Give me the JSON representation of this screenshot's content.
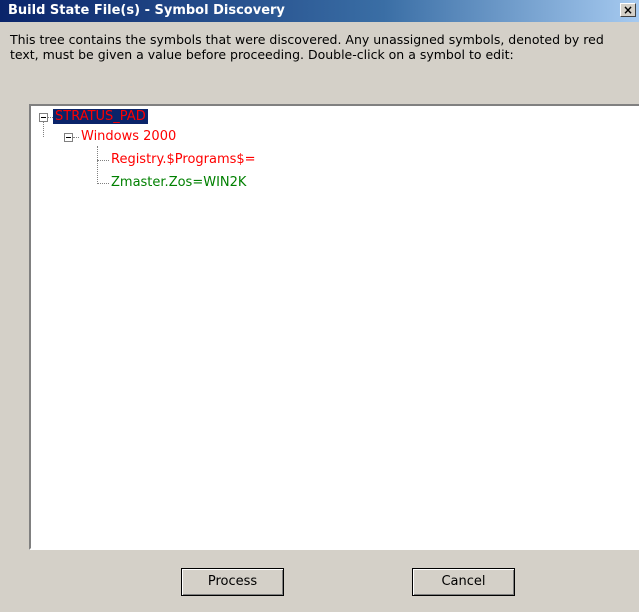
{
  "window": {
    "title": "Build State File(s) - Symbol Discovery",
    "close_glyph": "×"
  },
  "instructions": "This tree contains the symbols that were discovered.  Any unassigned symbols, denoted by red text, must be given a value before proceeding.  Double-click on a symbol to edit:",
  "tree": {
    "root": {
      "label": "STRATUS_PAD",
      "status": "unassigned",
      "selected": true
    },
    "child": {
      "label": "Windows 2000",
      "status": "unassigned"
    },
    "leaves": [
      {
        "label": "Registry.$Programs$=",
        "status": "unassigned"
      },
      {
        "label": "Zmaster.Zos=WIN2K",
        "status": "assigned"
      }
    ]
  },
  "colors": {
    "unassigned": "#ff0000",
    "assigned": "#008000",
    "selection": "#0a246a"
  },
  "buttons": {
    "process": "Process",
    "cancel": "Cancel"
  }
}
